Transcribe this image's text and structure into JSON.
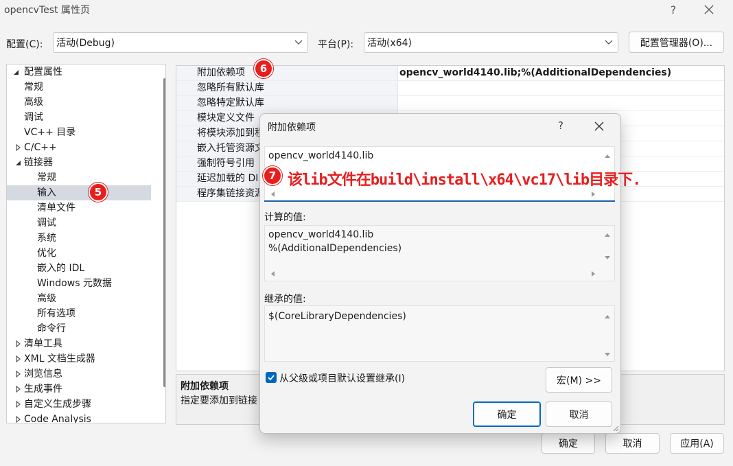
{
  "window": {
    "title": "opencvTest 属性页",
    "help_glyph": "?",
    "close_glyph": "✕"
  },
  "config_row": {
    "config_label": "配置(C):",
    "config_value": "活动(Debug)",
    "platform_label": "平台(P):",
    "platform_value": "活动(x64)",
    "manager_button": "配置管理器(O)..."
  },
  "tree": {
    "items": [
      {
        "label": "配置属性",
        "expander": "expanded",
        "level": 0
      },
      {
        "label": "常规",
        "expander": "none",
        "level": 1
      },
      {
        "label": "高级",
        "expander": "none",
        "level": 1
      },
      {
        "label": "调试",
        "expander": "none",
        "level": 1
      },
      {
        "label": "VC++ 目录",
        "expander": "none",
        "level": 1
      },
      {
        "label": "C/C++",
        "expander": "collapsed",
        "level": 1
      },
      {
        "label": "链接器",
        "expander": "expanded",
        "level": 1
      },
      {
        "label": "常规",
        "expander": "none",
        "level": 2
      },
      {
        "label": "输入",
        "expander": "none",
        "level": 2,
        "selected": true
      },
      {
        "label": "清单文件",
        "expander": "none",
        "level": 2
      },
      {
        "label": "调试",
        "expander": "none",
        "level": 2
      },
      {
        "label": "系统",
        "expander": "none",
        "level": 2
      },
      {
        "label": "优化",
        "expander": "none",
        "level": 2
      },
      {
        "label": "嵌入的 IDL",
        "expander": "none",
        "level": 2
      },
      {
        "label": "Windows 元数据",
        "expander": "none",
        "level": 2
      },
      {
        "label": "高级",
        "expander": "none",
        "level": 2
      },
      {
        "label": "所有选项",
        "expander": "none",
        "level": 2
      },
      {
        "label": "命令行",
        "expander": "none",
        "level": 2
      },
      {
        "label": "清单工具",
        "expander": "collapsed",
        "level": 1
      },
      {
        "label": "XML 文档生成器",
        "expander": "collapsed",
        "level": 1
      },
      {
        "label": "浏览信息",
        "expander": "collapsed",
        "level": 1
      },
      {
        "label": "生成事件",
        "expander": "collapsed",
        "level": 1
      },
      {
        "label": "自定义生成步骤",
        "expander": "collapsed",
        "level": 1
      },
      {
        "label": "Code Analysis",
        "expander": "collapsed",
        "level": 1
      }
    ]
  },
  "grid": {
    "rows": [
      {
        "name": "附加依赖项",
        "value": "opencv_world4140.lib;%(AdditionalDependencies)"
      },
      {
        "name": "忽略所有默认库",
        "value": ""
      },
      {
        "name": "忽略特定默认库",
        "value": ""
      },
      {
        "name": "模块定义文件",
        "value": ""
      },
      {
        "name": "将模块添加到程",
        "value": ""
      },
      {
        "name": "嵌入托管资源文",
        "value": ""
      },
      {
        "name": "强制符号引用",
        "value": ""
      },
      {
        "name": "延迟加载的 DI",
        "value": ""
      },
      {
        "name": "程序集链接资源",
        "value": ""
      }
    ]
  },
  "description": {
    "title": "附加依赖项",
    "text": "指定要添加到链接"
  },
  "bottom_buttons": {
    "ok": "确定",
    "cancel": "取消",
    "apply": "应用(A)"
  },
  "dialog": {
    "title": "附加依赖项",
    "help_glyph": "?",
    "input_value": "opencv_world4140.lib",
    "computed_label": "计算的值:",
    "computed_lines": [
      "opencv_world4140.lib",
      "%(AdditionalDependencies)"
    ],
    "inherited_label": "继承的值:",
    "inherited_lines": [
      "$(CoreLibraryDependencies)"
    ],
    "inherit_checkbox_label": "从父级或项目默认设置继承(I)",
    "inherit_checked": true,
    "macros_button": "宏(M) >>",
    "ok_button": "确定",
    "cancel_button": "取消"
  },
  "annotations": {
    "badge5": "5",
    "badge6": "6",
    "badge7": "7",
    "note": "该lib文件在build\\install\\x64\\vc17\\lib目录下.",
    "color": "#e81e1e"
  },
  "colors": {
    "accent": "#0067c0",
    "selection": "#d5d9e1",
    "background": "#f3f3f3"
  }
}
